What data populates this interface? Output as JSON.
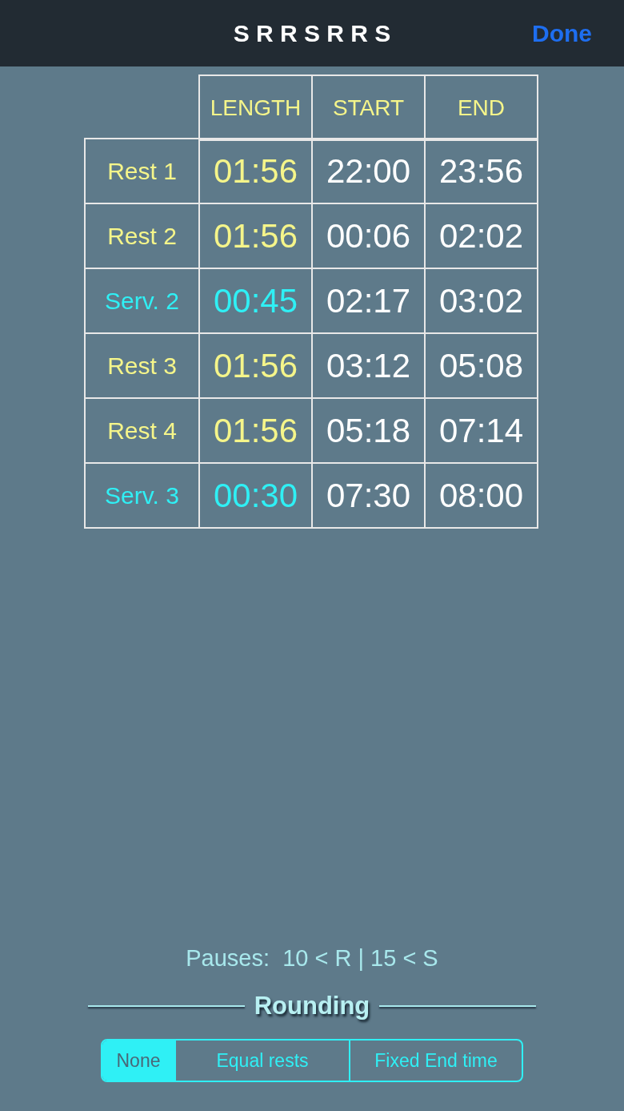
{
  "nav": {
    "title": "S R R S R R S",
    "done": "Done"
  },
  "table": {
    "columns": [
      "LENGTH",
      "START",
      "END"
    ],
    "rows": [
      {
        "kind": "rest",
        "label": "Rest 1",
        "length": "01:56",
        "start": "22:00",
        "end": "23:56"
      },
      {
        "kind": "rest",
        "label": "Rest 2",
        "length": "01:56",
        "start": "00:06",
        "end": "02:02"
      },
      {
        "kind": "serve",
        "label": "Serv. 2",
        "length": "00:45",
        "start": "02:17",
        "end": "03:02"
      },
      {
        "kind": "rest",
        "label": "Rest 3",
        "length": "01:56",
        "start": "03:12",
        "end": "05:08"
      },
      {
        "kind": "rest",
        "label": "Rest 4",
        "length": "01:56",
        "start": "05:18",
        "end": "07:14"
      },
      {
        "kind": "serve",
        "label": "Serv. 3",
        "length": "00:30",
        "start": "07:30",
        "end": "08:00"
      }
    ]
  },
  "pauses": "Pauses:  10 < R | 15 < S",
  "rounding": {
    "title": "Rounding",
    "options": [
      {
        "label": "None",
        "selected": true
      },
      {
        "label": "Equal rests",
        "selected": false
      },
      {
        "label": "Fixed End time",
        "selected": false
      }
    ]
  }
}
